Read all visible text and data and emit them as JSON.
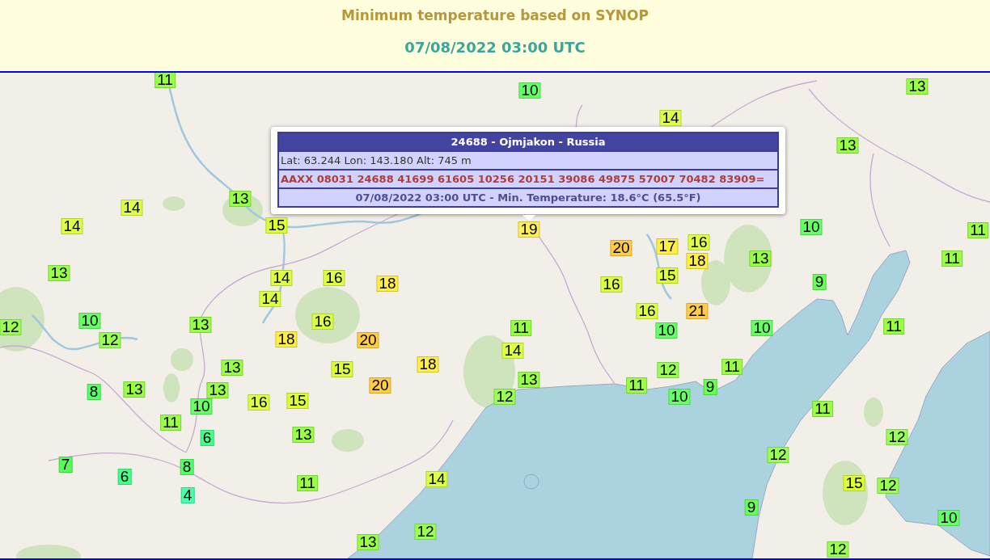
{
  "header": {
    "title": "Minimum temperature based on SYNOP",
    "date": "07/08/2022 03:00 UTC"
  },
  "popup": {
    "title": "24688 - Ojmjakon - Russia",
    "location": "Lat: 63.244 Lon: 143.180 Alt: 745 m",
    "synop": "AAXX 08031 24688 41699 61605 10256 20151 39086 49875 57007 70482 83909=",
    "reading": "07/08/2022 03:00 UTC - Min. Temperature: 18.6°C (65.5°F)"
  },
  "markers": [
    {
      "value": "11",
      "color": "#99ff44"
    },
    {
      "value": "10",
      "color": "#66ff66"
    },
    {
      "value": "13",
      "color": "#99ff44"
    },
    {
      "value": "14",
      "color": "#ddff44"
    },
    {
      "value": "13",
      "color": "#99ff44"
    },
    {
      "value": "14",
      "color": "#ddff44"
    },
    {
      "value": "13",
      "color": "#99ff44"
    },
    {
      "value": "14",
      "color": "#ddff44"
    },
    {
      "value": "15",
      "color": "#ddff33"
    },
    {
      "value": "19",
      "color": "#ffee55"
    },
    {
      "value": "10",
      "color": "#66ff66"
    },
    {
      "value": "11",
      "color": "#99ff44"
    },
    {
      "value": "20",
      "color": "#ffcc44"
    },
    {
      "value": "17",
      "color": "#ffee44"
    },
    {
      "value": "16",
      "color": "#ddff44"
    },
    {
      "value": "18",
      "color": "#ffee44"
    },
    {
      "value": "13",
      "color": "#99ff44"
    },
    {
      "value": "11",
      "color": "#99ff44"
    },
    {
      "value": "13",
      "color": "#99ff44"
    },
    {
      "value": "14",
      "color": "#ddff44"
    },
    {
      "value": "16",
      "color": "#ddff44"
    },
    {
      "value": "18",
      "color": "#ffee44"
    },
    {
      "value": "16",
      "color": "#ddff44"
    },
    {
      "value": "15",
      "color": "#ddff33"
    },
    {
      "value": "9",
      "color": "#66ff55"
    },
    {
      "value": "14",
      "color": "#ddff44"
    },
    {
      "value": "16",
      "color": "#ddff44"
    },
    {
      "value": "21",
      "color": "#ffcc44"
    },
    {
      "value": "12",
      "color": "#99ff55"
    },
    {
      "value": "10",
      "color": "#66ff66"
    },
    {
      "value": "13",
      "color": "#99ff44"
    },
    {
      "value": "16",
      "color": "#ddff44"
    },
    {
      "value": "11",
      "color": "#99ff44"
    },
    {
      "value": "10",
      "color": "#66ff66"
    },
    {
      "value": "10",
      "color": "#66ff66"
    },
    {
      "value": "11",
      "color": "#99ff44"
    },
    {
      "value": "12",
      "color": "#99ff55"
    },
    {
      "value": "18",
      "color": "#ffee44"
    },
    {
      "value": "20",
      "color": "#ffcc44"
    },
    {
      "value": "14",
      "color": "#ddff44"
    },
    {
      "value": "13",
      "color": "#99ff44"
    },
    {
      "value": "15",
      "color": "#ddff33"
    },
    {
      "value": "18",
      "color": "#ffee44"
    },
    {
      "value": "12",
      "color": "#99ff55"
    },
    {
      "value": "11",
      "color": "#99ff44"
    },
    {
      "value": "8",
      "color": "#55ff66"
    },
    {
      "value": "13",
      "color": "#99ff44"
    },
    {
      "value": "10",
      "color": "#66ff66"
    },
    {
      "value": "13",
      "color": "#99ff44"
    },
    {
      "value": "16",
      "color": "#ddff44"
    },
    {
      "value": "15",
      "color": "#ddff33"
    },
    {
      "value": "20",
      "color": "#ffcc44"
    },
    {
      "value": "12",
      "color": "#99ff55"
    },
    {
      "value": "13",
      "color": "#99ff44"
    },
    {
      "value": "11",
      "color": "#99ff44"
    },
    {
      "value": "10",
      "color": "#66ff66"
    },
    {
      "value": "9",
      "color": "#66ff55"
    },
    {
      "value": "11",
      "color": "#99ff44"
    },
    {
      "value": "11",
      "color": "#99ff44"
    },
    {
      "value": "6",
      "color": "#44ff88"
    },
    {
      "value": "13",
      "color": "#99ff44"
    },
    {
      "value": "12",
      "color": "#99ff55"
    },
    {
      "value": "12",
      "color": "#99ff55"
    },
    {
      "value": "7",
      "color": "#55ff55"
    },
    {
      "value": "8",
      "color": "#55ff66"
    },
    {
      "value": "6",
      "color": "#44ff88"
    },
    {
      "value": "11",
      "color": "#99ff44"
    },
    {
      "value": "14",
      "color": "#ddff44"
    },
    {
      "value": "15",
      "color": "#ddff33"
    },
    {
      "value": "12",
      "color": "#99ff55"
    },
    {
      "value": "4",
      "color": "#44ffaa"
    },
    {
      "value": "9",
      "color": "#66ff55"
    },
    {
      "value": "10",
      "color": "#66ff66"
    },
    {
      "value": "12",
      "color": "#99ff55"
    },
    {
      "value": "13",
      "color": "#99ff44"
    },
    {
      "value": "12",
      "color": "#99ff55"
    }
  ]
}
